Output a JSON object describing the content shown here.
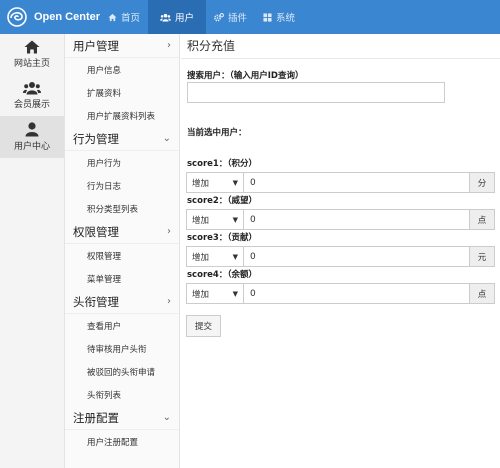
{
  "brand": {
    "name": "Open Center",
    "logo_icon": "swirl-logo-icon"
  },
  "topnav": [
    {
      "label": "首页",
      "icon": "home-icon",
      "active": false
    },
    {
      "label": "用户",
      "icon": "users-icon",
      "active": true
    },
    {
      "label": "插件",
      "icon": "cogs-icon",
      "active": false
    },
    {
      "label": "系统",
      "icon": "windows-icon",
      "active": false
    }
  ],
  "rail": [
    {
      "label": "网站主页",
      "icon": "home-icon"
    },
    {
      "label": "会员展示",
      "icon": "users-icon"
    },
    {
      "label": "用户中心",
      "icon": "user-icon",
      "active": true
    }
  ],
  "sidebar": {
    "groups": [
      {
        "title": "用户管理",
        "chevron": "›",
        "items": [
          "用户信息",
          "扩展资料",
          "用户扩展资料列表"
        ]
      },
      {
        "title": "行为管理",
        "chevron": "⌄",
        "items": [
          "用户行为",
          "行为日志",
          "积分类型列表"
        ]
      },
      {
        "title": "权限管理",
        "chevron": "›",
        "items": [
          "权限管理",
          "菜单管理"
        ]
      },
      {
        "title": "头衔管理",
        "chevron": "›",
        "items": [
          "查看用户",
          "待审核用户头衔",
          "被驳回的头衔申请",
          "头衔列表"
        ]
      },
      {
        "title": "注册配置",
        "chevron": "⌄",
        "items": [
          "用户注册配置"
        ]
      }
    ]
  },
  "main": {
    "title": "积分充值",
    "search_label": "搜索用户：（输入用户ID查询）",
    "search_value": "",
    "current_user_label": "当前选中用户：",
    "scores": [
      {
        "label": "score1：（积分）",
        "op": "增加",
        "value": "0",
        "unit": "分"
      },
      {
        "label": "score2：（威望）",
        "op": "增加",
        "value": "0",
        "unit": "点"
      },
      {
        "label": "score3：（贡献）",
        "op": "增加",
        "value": "0",
        "unit": "元"
      },
      {
        "label": "score4：（余额）",
        "op": "增加",
        "value": "0",
        "unit": "点"
      }
    ],
    "submit_label": "提交"
  },
  "colors": {
    "navbar": "#3a86d1",
    "navbar_active": "#2a6db3"
  }
}
